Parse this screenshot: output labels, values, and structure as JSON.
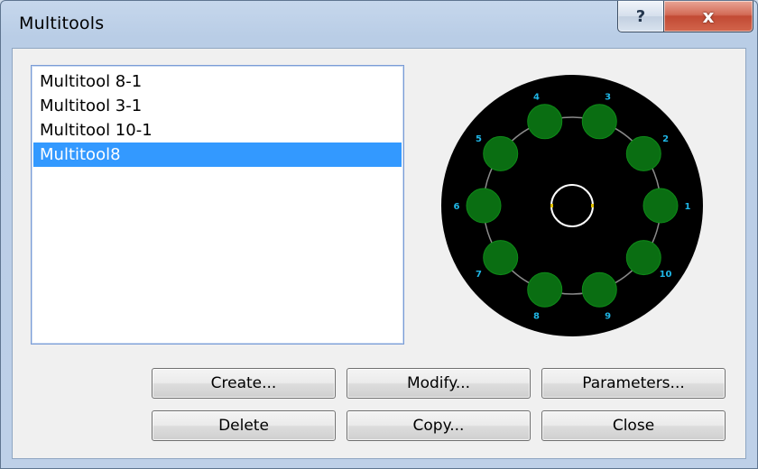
{
  "window": {
    "title": "Multitools",
    "help_symbol": "?",
    "close_symbol": "x"
  },
  "multitools": {
    "items": [
      {
        "label": "Multitool 8-1",
        "selected": false
      },
      {
        "label": "Multitool 3-1",
        "selected": false
      },
      {
        "label": "Multitool 10-1",
        "selected": false
      },
      {
        "label": "Multitool8",
        "selected": true
      }
    ]
  },
  "preview": {
    "station_labels": [
      "1",
      "2",
      "3",
      "4",
      "5",
      "6",
      "7",
      "8",
      "9",
      "10"
    ],
    "colors": {
      "disk": "#000000",
      "station_fill": "#0a6e12",
      "station_stroke": "#0e8a18",
      "ring": "#8a8a8a",
      "center_ring": "#ffffff",
      "marker": "#e0c000",
      "label": "#1fb6e6"
    }
  },
  "buttons": {
    "create": "Create...",
    "modify": "Modify...",
    "parameters": "Parameters...",
    "delete": "Delete",
    "copy": "Copy...",
    "close": "Close"
  }
}
